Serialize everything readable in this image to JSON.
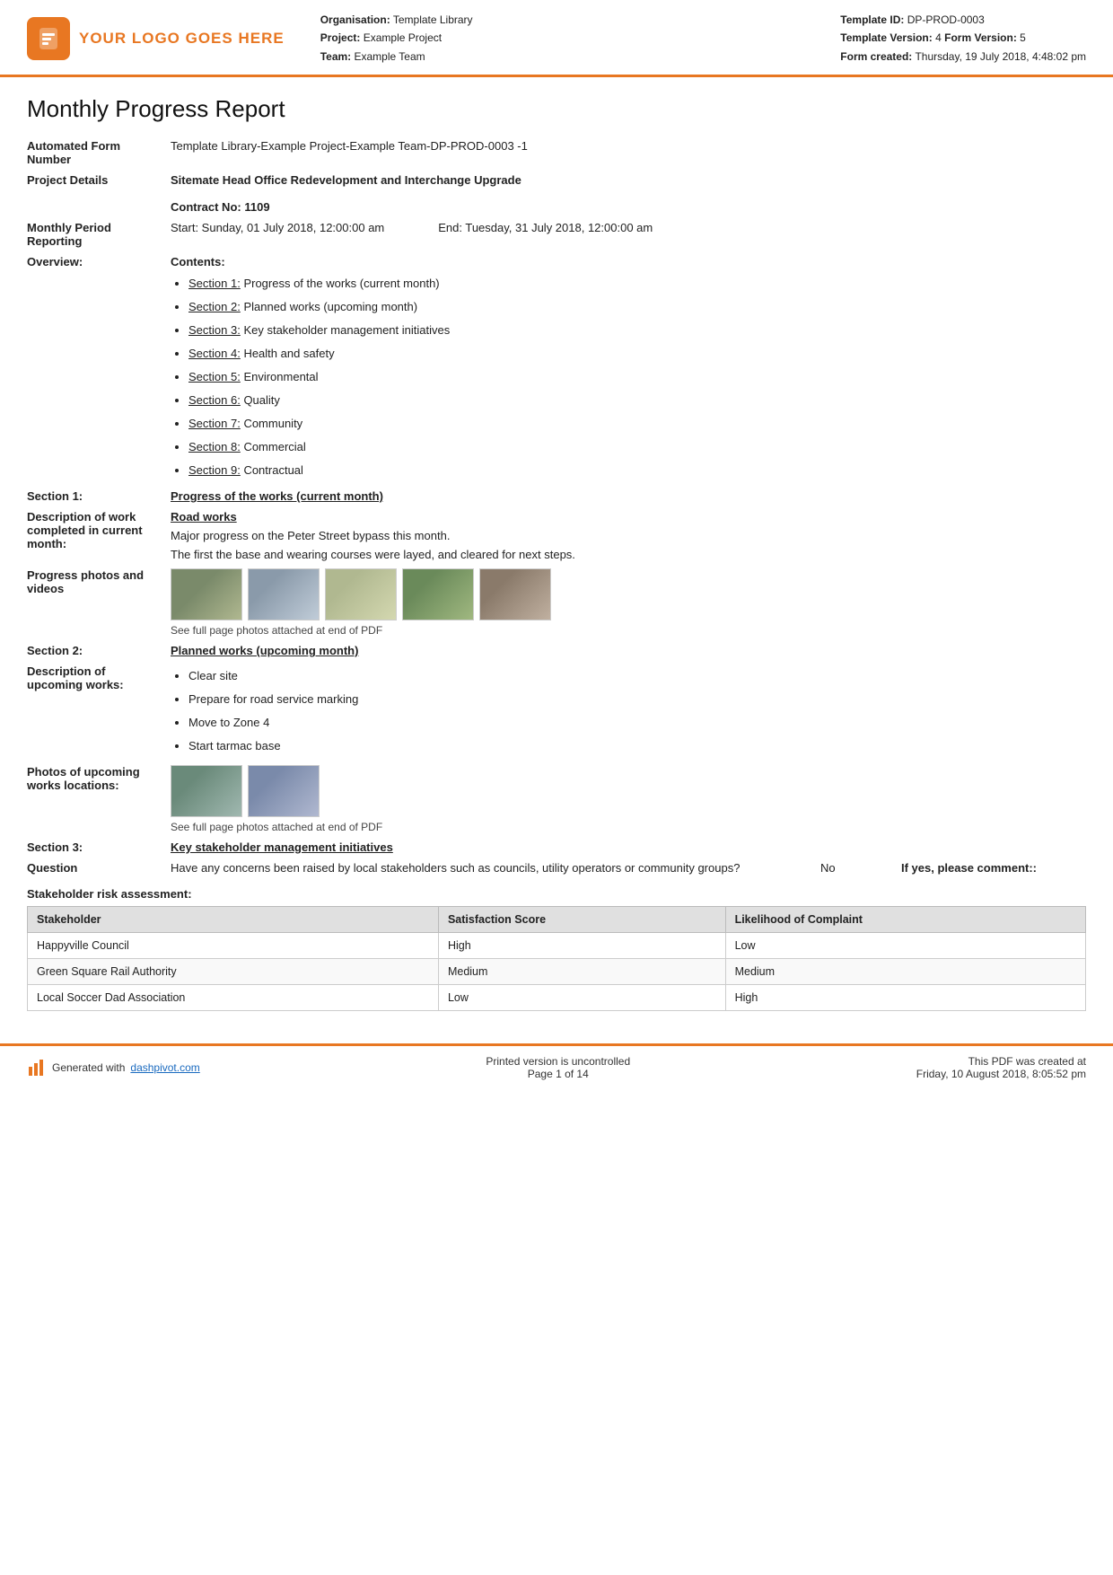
{
  "header": {
    "logo_text": "YOUR LOGO GOES HERE",
    "org_label": "Organisation:",
    "org_value": "Template Library",
    "project_label": "Project:",
    "project_value": "Example Project",
    "team_label": "Team:",
    "team_value": "Example Team",
    "template_id_label": "Template ID:",
    "template_id_value": "DP-PROD-0003",
    "template_version_label": "Template Version:",
    "template_version_value": "4",
    "form_version_label": "Form Version:",
    "form_version_value": "5",
    "form_created_label": "Form created:",
    "form_created_value": "Thursday, 19 July 2018, 4:48:02 pm"
  },
  "report": {
    "title": "Monthly Progress Report",
    "automated_form_number_label": "Automated Form Number",
    "automated_form_number_value": "Template Library-Example Project-Example Team-DP-PROD-0003   -1",
    "project_details_label": "Project Details",
    "project_details_value": "Sitemate Head Office Redevelopment and Interchange Upgrade",
    "contract_no_label": "Contract No:",
    "contract_no_value": "1109",
    "monthly_period_label": "Monthly Period Reporting",
    "period_start": "Start: Sunday, 01 July 2018, 12:00:00 am",
    "period_end": "End: Tuesday, 31 July 2018, 12:00:00 am",
    "overview_label": "Overview:",
    "contents_label": "Contents:",
    "contents_items": [
      {
        "link": "Section 1:",
        "text": " Progress of the works (current month)"
      },
      {
        "link": "Section 2:",
        "text": " Planned works (upcoming month)"
      },
      {
        "link": "Section 3:",
        "text": " Key stakeholder management initiatives"
      },
      {
        "link": "Section 4:",
        "text": " Health and safety"
      },
      {
        "link": "Section 5:",
        "text": " Environmental"
      },
      {
        "link": "Section 6:",
        "text": " Quality"
      },
      {
        "link": "Section 7:",
        "text": " Community"
      },
      {
        "link": "Section 8:",
        "text": " Commercial"
      },
      {
        "link": "Section 9:",
        "text": " Contractual"
      }
    ],
    "section1_label": "Section 1:",
    "section1_title": "Progress of the works (current month)",
    "desc_work_label": "Description of work completed in current month:",
    "road_works_title": "Road works",
    "road_works_desc1": "Major progress on the Peter Street bypass this month.",
    "road_works_desc2": "The first the base and wearing courses were layed, and cleared for next steps.",
    "progress_photos_label": "Progress photos and videos",
    "photos_caption": "See full page photos attached at end of PDF",
    "section2_label": "Section 2:",
    "section2_title": "Planned works (upcoming month)",
    "upcoming_works_label": "Description of upcoming works:",
    "upcoming_works_items": [
      "Clear site",
      "Prepare for road service marking",
      "Move to Zone 4",
      "Start tarmac base"
    ],
    "upcoming_photos_label": "Photos of upcoming works locations:",
    "upcoming_photos_caption": "See full page photos attached at end of PDF",
    "section3_label": "Section 3:",
    "section3_title": "Key stakeholder management initiatives",
    "question_label": "Question",
    "question_text": "Have any concerns been raised by local stakeholders such as councils, utility operators or community groups?",
    "question_answer": "No",
    "question_comment_label": "If yes, please comment::",
    "stakeholder_risk_label": "Stakeholder risk assessment:",
    "stk_col1": "Stakeholder",
    "stk_col2": "Satisfaction Score",
    "stk_col3": "Likelihood of Complaint",
    "stk_rows": [
      {
        "name": "Happyville Council",
        "score": "High",
        "likelihood": "Low"
      },
      {
        "name": "Green Square Rail Authority",
        "score": "Medium",
        "likelihood": "Medium"
      },
      {
        "name": "Local Soccer Dad Association",
        "score": "Low",
        "likelihood": "High"
      }
    ]
  },
  "footer": {
    "generated_text": "Generated with ",
    "generated_link": "dashpivot.com",
    "print_line1": "Printed version is uncontrolled",
    "print_line2": "Page 1 of 14",
    "created_line1": "This PDF was created at",
    "created_line2": "Friday, 10 August 2018, 8:05:52 pm"
  }
}
